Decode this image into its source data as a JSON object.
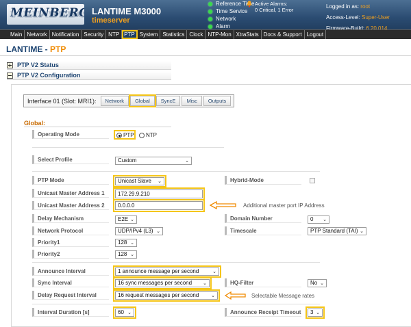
{
  "header": {
    "logo_text": "MEINBERG",
    "product": "LANTIME M3000",
    "hostname": "timeserver",
    "status_items": [
      "Reference Time",
      "Time Service",
      "Network",
      "Alarm"
    ],
    "alarms_title": "Active Alarms:",
    "alarms_detail": "0 Critical, 1 Error",
    "login_label": "Logged in as:",
    "login_user": "root",
    "access_label": "Access-Level:",
    "access_value": "Super-User",
    "firmware_label": "Firmware-Build:",
    "firmware_value": "6.20.014"
  },
  "nav": {
    "items": [
      "Main",
      "Network",
      "Notification",
      "Security",
      "NTP",
      "PTP",
      "System",
      "Statistics",
      "Clock",
      "NTP-Mon",
      "XtraStats",
      "Docs & Support",
      "Logout"
    ],
    "active": "PTP"
  },
  "page": {
    "title_left": "LANTIME - ",
    "title_right": "PTP",
    "section_status": "PTP V2 Status",
    "section_config": "PTP V2 Configuration"
  },
  "interface": {
    "label": "Interface 01 (Slot: MRI1):",
    "tabs": [
      "Network",
      "Global",
      "SyncE",
      "Misc",
      "Outputs"
    ],
    "selected_tab": "Global"
  },
  "global": {
    "title": "Global:",
    "operating_mode_label": "Operating Mode",
    "mode_options": [
      "PTP",
      "NTP"
    ],
    "mode_selected": "PTP",
    "select_profile_label": "Select Profile",
    "select_profile_value": "Custom",
    "ptp_mode_label": "PTP Mode",
    "ptp_mode_value": "Unicast Slave",
    "hybrid_mode_label": "Hybrid-Mode",
    "unicast_master_1_label": "Unicast Master Address 1",
    "unicast_master_1_value": "172.29.9.210",
    "unicast_master_2_label": "Unicast Master Address 2",
    "unicast_master_2_value": "0.0.0.0",
    "additional_note": "Additional master port IP Address",
    "delay_mechanism_label": "Delay Mechanism",
    "delay_mechanism_value": "E2E",
    "domain_number_label": "Domain Number",
    "domain_number_value": "0",
    "network_protocol_label": "Network Protocol",
    "network_protocol_value": "UDP/IPv4 (L3)",
    "timescale_label": "Timescale",
    "timescale_value": "PTP Standard (TAI)",
    "priority1_label": "Priority1",
    "priority1_value": "128",
    "priority2_label": "Priority2",
    "priority2_value": "128",
    "announce_interval_label": "Announce Interval",
    "announce_interval_value": "1 announce message per second",
    "sync_interval_label": "Sync Interval",
    "sync_interval_value": "16 sync messages per second",
    "hq_filter_label": "HQ-Filter",
    "hq_filter_value": "No",
    "delay_request_label": "Delay Request Interval",
    "delay_request_value": "16 request messages per second",
    "rates_note": "Selectable Message rates",
    "interval_duration_label": "Interval Duration [s]",
    "interval_duration_value": "60",
    "announce_timeout_label": "Announce Receipt Timeout",
    "announce_timeout_value": "3"
  },
  "colors": {
    "header_bg": "#2b4c72",
    "accent_orange": "#f08a00",
    "highlight_yellow": "#f5c518",
    "status_green": "#39d94a"
  }
}
